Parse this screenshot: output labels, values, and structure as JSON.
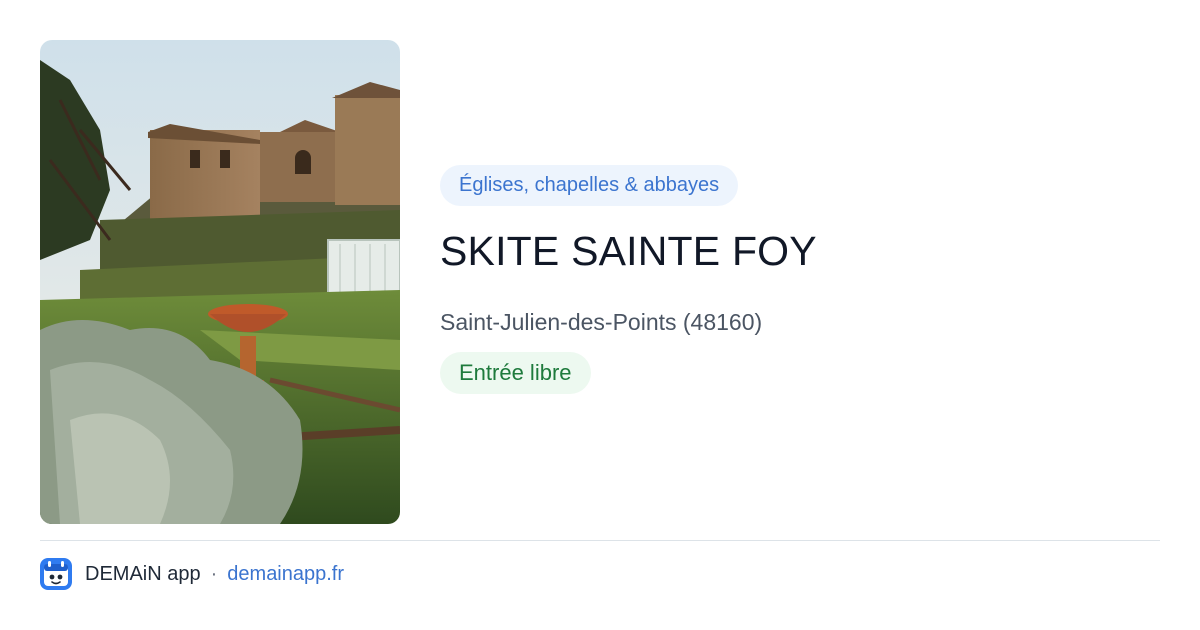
{
  "place": {
    "category": "Églises, chapelles & abbayes",
    "name": "SKITE SAINTE FOY",
    "location": "Saint-Julien-des-Points (48160)",
    "access": "Entrée libre"
  },
  "footer": {
    "app_name": "DEMAiN app",
    "separator": "·",
    "domain": "demainapp.fr"
  },
  "colors": {
    "category_text": "#3b74cf",
    "category_bg": "#edf4fd",
    "access_text": "#1e7a3c",
    "access_bg": "#edf9f0",
    "link": "#3b74cf"
  },
  "icons": {
    "app_icon": "demain-app-icon"
  }
}
